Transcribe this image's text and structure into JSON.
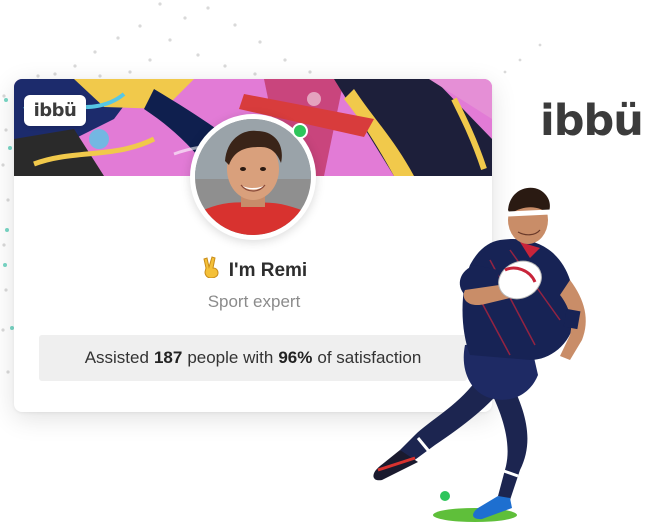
{
  "brand": {
    "card_logo": "ibbü",
    "main_logo": "ibbü",
    "accent_color": "#2ec55b"
  },
  "profile": {
    "greeting_icon": "victory-hand-icon",
    "name_line": "I'm Remi",
    "role": "Sport expert",
    "status": "online",
    "stats": {
      "prefix": "Assisted",
      "people": "187",
      "middle": "people with",
      "satisfaction": "96%",
      "suffix": "of satisfaction"
    }
  },
  "illustration": {
    "banner": "graffiti-art-banner",
    "player": "rugby-player-running-with-ball"
  }
}
